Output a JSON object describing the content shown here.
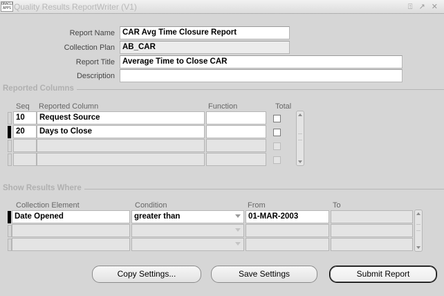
{
  "window": {
    "icon_text": "ORACLE APPS",
    "title": "Quality Results ReportWriter (V1)",
    "controls": [
      "⍐",
      "↗",
      "✕"
    ]
  },
  "header_form": {
    "report_name": {
      "label": "Report Name",
      "value": "CAR Avg Time Closure Report"
    },
    "collection_plan": {
      "label": "Collection Plan",
      "value": "AB_CAR"
    },
    "report_title": {
      "label": "Report Title",
      "value": "Average Time to Close CAR"
    },
    "description": {
      "label": "Description",
      "value": ""
    }
  },
  "reported_columns": {
    "section_title": "Reported Columns",
    "headers": {
      "seq": "Seq",
      "column": "Reported Column",
      "function": "Function",
      "total": "Total"
    },
    "rows": [
      {
        "seq": "10",
        "column": "Request Source",
        "function": "",
        "total": false
      },
      {
        "seq": "20",
        "column": "Days to Close",
        "function": "",
        "total": false
      },
      {
        "seq": "",
        "column": "",
        "function": "",
        "total": false
      },
      {
        "seq": "",
        "column": "",
        "function": "",
        "total": false
      }
    ]
  },
  "show_results_where": {
    "section_title": "Show Results Where",
    "headers": {
      "element": "Collection Element",
      "condition": "Condition",
      "from": "From",
      "to": "To"
    },
    "rows": [
      {
        "element": "Date Opened",
        "condition": "greater than",
        "from": "01-MAR-2003",
        "to": ""
      },
      {
        "element": "",
        "condition": "",
        "from": "",
        "to": ""
      },
      {
        "element": "",
        "condition": "",
        "from": "",
        "to": ""
      }
    ]
  },
  "buttons": {
    "copy_settings": "Copy Settings...",
    "save_settings": "Save Settings",
    "submit_report": "Submit Report"
  }
}
